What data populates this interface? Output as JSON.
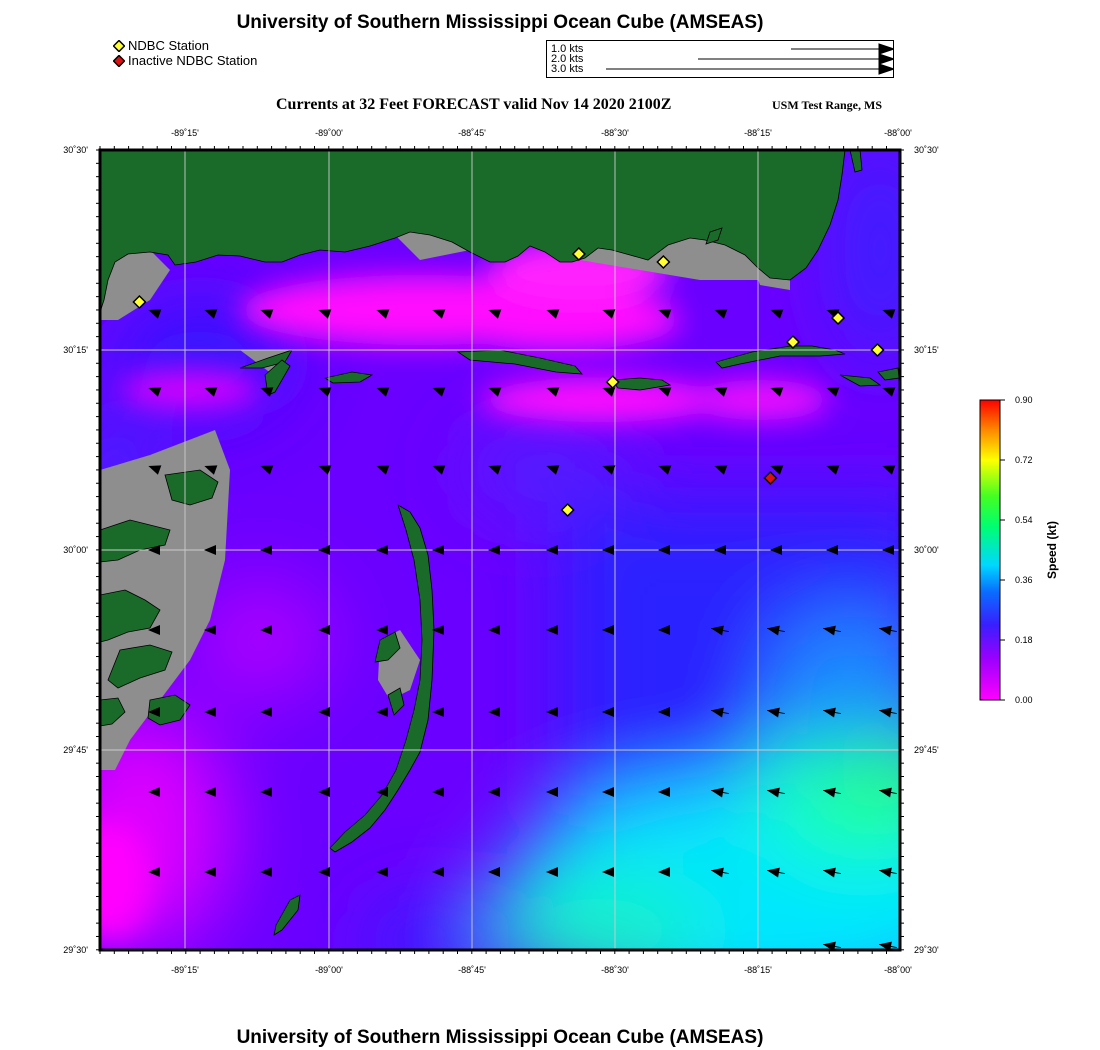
{
  "header": {
    "title": "University of Southern Mississippi Ocean Cube (AMSEAS)",
    "subtitle": "Currents at 32 Feet FORECAST valid Nov 14 2020 2100Z",
    "region": "USM Test Range, MS"
  },
  "footer": {
    "title": "University of Southern Mississippi Ocean Cube (AMSEAS)"
  },
  "legend": {
    "active_station": "NDBC Station",
    "inactive_station": "Inactive NDBC Station",
    "active_color": "#ffff33",
    "inactive_color": "#dd1111"
  },
  "vector_scale": [
    {
      "label": "1.0 kts",
      "kts": 1.0
    },
    {
      "label": "2.0 kts",
      "kts": 2.0
    },
    {
      "label": "3.0 kts",
      "kts": 3.0
    }
  ],
  "axes": {
    "lon_ticks": [
      "-89˚15'",
      "-89˚00'",
      "-88˚45'",
      "-88˚30'",
      "-88˚15'",
      "-88˚00'"
    ],
    "lat_ticks": [
      "30˚30'",
      "30˚15'",
      "30˚00'",
      "29˚45'",
      "29˚30'"
    ],
    "lon_range": [
      -89.42,
      -88.0
    ],
    "lat_range": [
      29.5,
      30.5
    ]
  },
  "colorbar": {
    "label": "Speed (kt)",
    "ticks": [
      "0.90",
      "0.72",
      "0.54",
      "0.36",
      "0.18",
      "0.00"
    ],
    "range": [
      0.0,
      0.9
    ],
    "colors": [
      "#ff00ff",
      "#8000ff",
      "#1e3cff",
      "#00e0ff",
      "#00ff40",
      "#ffff00",
      "#ff0000"
    ]
  },
  "colors": {
    "land": "#1a6b2a",
    "shallow": "#8e8e8e",
    "grid": "#cccccc"
  },
  "stations": [
    {
      "lon": -89.35,
      "lat": 30.31,
      "active": true
    },
    {
      "lon": -88.57,
      "lat": 30.37,
      "active": true
    },
    {
      "lon": -88.42,
      "lat": 30.36,
      "active": true
    },
    {
      "lon": -88.11,
      "lat": 30.29,
      "active": true
    },
    {
      "lon": -88.19,
      "lat": 30.26,
      "active": true
    },
    {
      "lon": -88.04,
      "lat": 30.25,
      "active": true
    },
    {
      "lon": -88.51,
      "lat": 30.21,
      "active": true
    },
    {
      "lon": -88.59,
      "lat": 30.05,
      "active": true
    },
    {
      "lon": -88.23,
      "lat": 30.09,
      "active": false
    }
  ]
}
